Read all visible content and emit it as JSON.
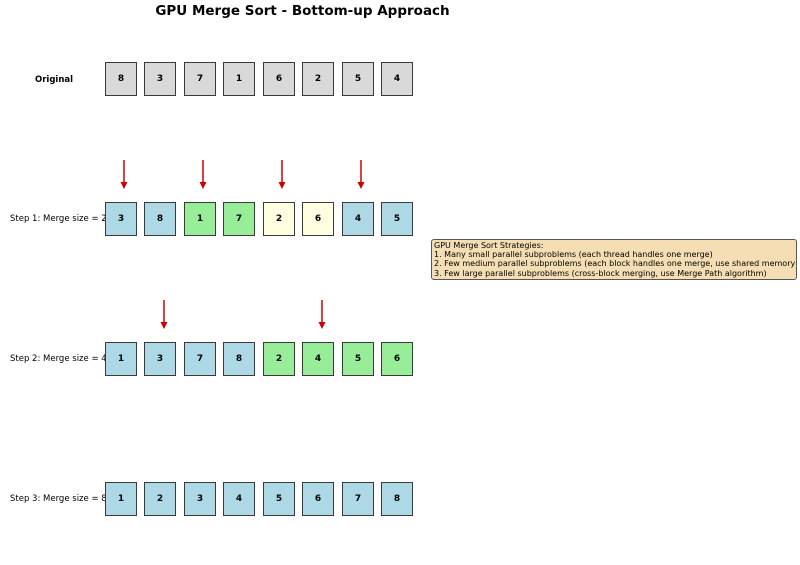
{
  "title": "GPU Merge Sort - Bottom-up Approach",
  "colors": {
    "gray": "#d9d9d9",
    "blue": "#add8e6",
    "green": "#98ee98",
    "yellow": "#fffee0",
    "arrow": "#cc0000",
    "note_bg": "#f5deb3"
  },
  "rows": [
    {
      "label": "Original",
      "values": [
        "8",
        "3",
        "7",
        "1",
        "6",
        "2",
        "5",
        "4"
      ],
      "colors": [
        "gray",
        "gray",
        "gray",
        "gray",
        "gray",
        "gray",
        "gray",
        "gray"
      ]
    },
    {
      "label": "Step 1: Merge size = 2",
      "values": [
        "3",
        "8",
        "1",
        "7",
        "2",
        "6",
        "4",
        "5"
      ],
      "colors": [
        "blue",
        "blue",
        "green",
        "green",
        "yellow",
        "yellow",
        "blue",
        "blue"
      ]
    },
    {
      "label": "Step 2: Merge size = 4",
      "values": [
        "1",
        "3",
        "7",
        "8",
        "2",
        "4",
        "5",
        "6"
      ],
      "colors": [
        "blue",
        "blue",
        "blue",
        "blue",
        "green",
        "green",
        "green",
        "green"
      ]
    },
    {
      "label": "Step 3: Merge size = 8",
      "values": [
        "1",
        "2",
        "3",
        "4",
        "5",
        "6",
        "7",
        "8"
      ],
      "colors": [
        "blue",
        "blue",
        "blue",
        "blue",
        "blue",
        "blue",
        "blue",
        "blue"
      ]
    }
  ],
  "note": {
    "title": "GPU Merge Sort Strategies:",
    "items": [
      "1. Many small parallel subproblems (each thread handles one merge)",
      "2. Few medium parallel subproblems (each block handles one merge, use shared memory)",
      "3. Few large parallel subproblems (cross-block merging, use Merge Path algorithm)"
    ]
  }
}
